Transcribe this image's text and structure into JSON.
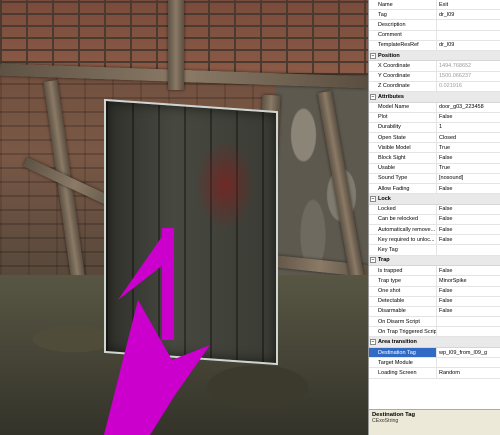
{
  "viewport": {
    "arrow_color": "#cc00cc"
  },
  "properties": {
    "general": [
      {
        "label": "Name",
        "value": "Exit"
      },
      {
        "label": "Tag",
        "value": "dr_l09"
      },
      {
        "label": "Description",
        "value": ""
      },
      {
        "label": "Comment",
        "value": ""
      },
      {
        "label": "TemplateResRef",
        "value": "dr_l09"
      }
    ],
    "categories": [
      {
        "title": "Position",
        "rows": [
          {
            "label": "X Coordinate",
            "value": "1494.768652",
            "dim": true
          },
          {
            "label": "Y Coordinate",
            "value": "1500.066237",
            "dim": true
          },
          {
            "label": "Z Coordinate",
            "value": "0.021916",
            "dim": true
          }
        ]
      },
      {
        "title": "Attributes",
        "rows": [
          {
            "label": "Model Name",
            "value": "door_g03_223458"
          },
          {
            "label": "Plot",
            "value": "False"
          },
          {
            "label": "Durability",
            "value": "1"
          },
          {
            "label": "Open State",
            "value": "Closed"
          },
          {
            "label": "Visible Model",
            "value": "True"
          },
          {
            "label": "Block Sight",
            "value": "False"
          },
          {
            "label": "Usable",
            "value": "True"
          },
          {
            "label": "Sound Type",
            "value": "[nosound]"
          },
          {
            "label": "Allow Fading",
            "value": "False"
          }
        ]
      },
      {
        "title": "Lock",
        "rows": [
          {
            "label": "Locked",
            "value": "False"
          },
          {
            "label": "Can be relocked",
            "value": "False"
          },
          {
            "label": "Automatically remove...",
            "value": "False"
          },
          {
            "label": "Key required to unloc...",
            "value": "False"
          },
          {
            "label": "Key Tag",
            "value": ""
          }
        ]
      },
      {
        "title": "Trap",
        "rows": [
          {
            "label": "Is trapped",
            "value": "False"
          },
          {
            "label": "Trap type",
            "value": "MinorSpike"
          },
          {
            "label": "One shot",
            "value": "False"
          },
          {
            "label": "Detectable",
            "value": "False"
          },
          {
            "label": "Disarmable",
            "value": "False"
          },
          {
            "label": "On Disarm Script",
            "value": ""
          },
          {
            "label": "On Trap Triggered Script",
            "value": ""
          }
        ]
      },
      {
        "title": "Area transition",
        "rows": [
          {
            "label": "Destination Tag",
            "value": "wp_l09_from_l09_g",
            "selected": true
          },
          {
            "label": "Target Module",
            "value": ""
          },
          {
            "label": "Loading Screen",
            "value": "Random"
          }
        ]
      }
    ],
    "toggle_symbol": "−"
  },
  "description": {
    "title": "Destination Tag",
    "subtitle": "CExoString"
  }
}
